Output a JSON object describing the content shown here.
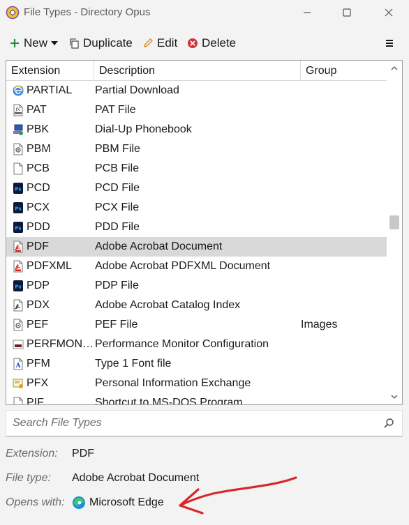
{
  "window": {
    "title": "File Types - Directory Opus"
  },
  "toolbar": {
    "new_label": "New",
    "duplicate_label": "Duplicate",
    "edit_label": "Edit",
    "delete_label": "Delete"
  },
  "list": {
    "columns": [
      "Extension",
      "Description",
      "Group"
    ],
    "rows": [
      {
        "ext": "PARTIAL",
        "desc": "Partial Download",
        "group": "",
        "icon": "ie-download-icon"
      },
      {
        "ext": "PAT",
        "desc": "PAT File",
        "group": "",
        "icon": "function-file-icon"
      },
      {
        "ext": "PBK",
        "desc": "Dial-Up Phonebook",
        "group": "",
        "icon": "network-computer-icon"
      },
      {
        "ext": "PBM",
        "desc": "PBM File",
        "group": "",
        "icon": "image-file-icon"
      },
      {
        "ext": "PCB",
        "desc": "PCB File",
        "group": "",
        "icon": "blank-file-icon"
      },
      {
        "ext": "PCD",
        "desc": "PCD File",
        "group": "",
        "icon": "photoshop-file-icon"
      },
      {
        "ext": "PCX",
        "desc": "PCX File",
        "group": "",
        "icon": "photoshop-file-icon"
      },
      {
        "ext": "PDD",
        "desc": "PDD File",
        "group": "",
        "icon": "photoshop-file-icon"
      },
      {
        "ext": "PDF",
        "desc": "Adobe Acrobat Document",
        "group": "",
        "icon": "pdf-file-icon",
        "selected": true
      },
      {
        "ext": "PDFXML",
        "desc": "Adobe Acrobat PDFXML Document",
        "group": "",
        "icon": "pdf-file-icon"
      },
      {
        "ext": "PDP",
        "desc": "PDP File",
        "group": "",
        "icon": "photoshop-file-icon"
      },
      {
        "ext": "PDX",
        "desc": "Adobe Acrobat Catalog Index",
        "group": "",
        "icon": "acrobat-file-icon"
      },
      {
        "ext": "PEF",
        "desc": "PEF File",
        "group": "Images",
        "icon": "image-file-icon"
      },
      {
        "ext": "PERFMON…",
        "desc": "Performance Monitor Configuration",
        "group": "",
        "icon": "perfmon-file-icon"
      },
      {
        "ext": "PFM",
        "desc": "Type 1 Font file",
        "group": "",
        "icon": "font-file-icon"
      },
      {
        "ext": "PFX",
        "desc": "Personal Information Exchange",
        "group": "",
        "icon": "certificate-file-icon"
      },
      {
        "ext": "PIF",
        "desc": "Shortcut to MS-DOS Program",
        "group": "",
        "icon": "blank-file-icon"
      }
    ]
  },
  "search": {
    "placeholder": "Search File Types"
  },
  "info": {
    "extension_label": "Extension:",
    "extension_value": "PDF",
    "filetype_label": "File type:",
    "filetype_value": "Adobe Acrobat Document",
    "opens_label": "Opens with:",
    "opens_value": "Microsoft Edge"
  },
  "colors": {
    "selected_row": "#d9d9d9",
    "new_plus": "#2e8b3e",
    "delete_red": "#d13438",
    "edit_pencil": "#d08a1a",
    "annotation_arrow": "#d8262a"
  }
}
